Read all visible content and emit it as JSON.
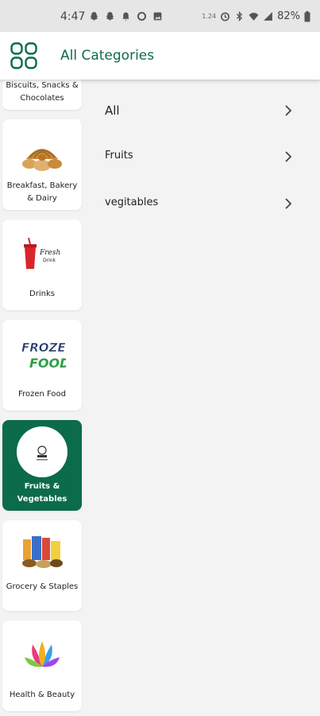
{
  "status_bar": {
    "time": "4:47",
    "data_speed": "1.24",
    "battery": "82%"
  },
  "app_bar": {
    "title": "All Categories",
    "menu_icon": "grid-icon"
  },
  "colors": {
    "brand_green": "#0c6b4a",
    "background": "#f3f3f3",
    "card": "#ffffff"
  },
  "categories": [
    {
      "label": "Biscuits, Snacks & Chocolates",
      "icon": "biscuits-image"
    },
    {
      "label": "Breakfast, Bakery & Dairy",
      "icon": "bakery-image"
    },
    {
      "label": "Drinks",
      "icon": "drinks-image"
    },
    {
      "label": "Frozen Food",
      "icon": "frozen-food-image"
    },
    {
      "label": "Fruits & Vegetables",
      "icon": "fruits-vegetables-image",
      "selected": true
    },
    {
      "label": "Grocery & Staples",
      "icon": "grocery-image"
    },
    {
      "label": "Health & Beauty",
      "icon": "health-beauty-image"
    }
  ],
  "subcategories": [
    {
      "label": "All"
    },
    {
      "label": "Fruits"
    },
    {
      "label": "vegitables"
    }
  ]
}
